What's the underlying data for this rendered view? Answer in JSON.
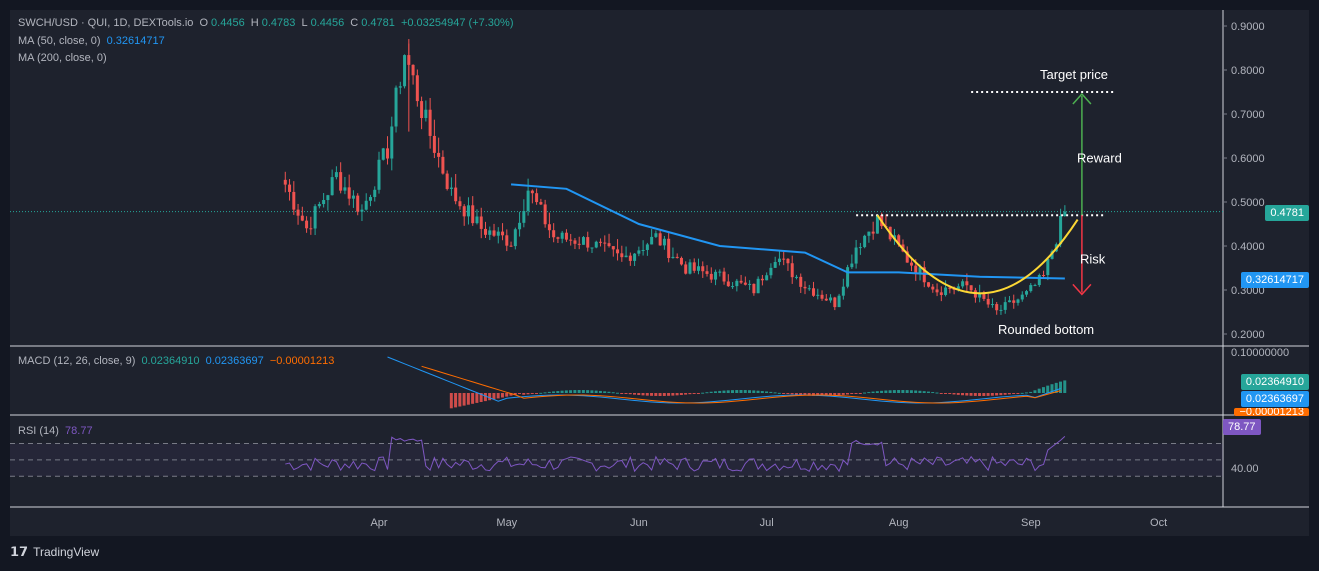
{
  "header": {
    "symbol": "SWCH/USD · QUI, 1D, DEXTools.io",
    "o_label": "O",
    "o_value": "0.4456",
    "h_label": "H",
    "h_value": "0.4783",
    "l_label": "L",
    "l_value": "0.4456",
    "c_label": "C",
    "c_value": "0.4781",
    "change": "+0.03254947 (+7.30%)"
  },
  "ma50": {
    "label": "MA (50, close, 0)",
    "value": "0.32614717"
  },
  "ma200": {
    "label": "MA (200, close, 0)"
  },
  "macd": {
    "label": "MACD (12, 26, close, 9)",
    "macd": "0.02364910",
    "signal": "0.02363697",
    "hist": "−0.00001213"
  },
  "rsi": {
    "label": "RSI (14)",
    "value": "78.77"
  },
  "annotations": {
    "target": "Target price",
    "reward": "Reward",
    "risk": "Risk",
    "bottom": "Rounded bottom"
  },
  "price_tags": {
    "last": "0.4781",
    "ma50": "0.32614717"
  },
  "macd_tags": {
    "macd": "0.02364910",
    "signal": "0.02363697",
    "hist": "−0.00001213"
  },
  "macd_axis": {
    "top": "0.10000000"
  },
  "rsi_axis": {
    "tick": "40.00"
  },
  "brand": "TradingView",
  "colors": {
    "up": "#26a69a",
    "down": "#ef5350",
    "ma50": "#2196f3",
    "macd": "#2196f3",
    "signal": "#ff6d00",
    "rsi": "#7e57c2",
    "arc": "#fdd835",
    "reward": "#4caf50",
    "risk": "#f23645"
  },
  "chart_data": {
    "type": "candlestick",
    "price_axis": {
      "ticks": [
        "0.9000",
        "0.8000",
        "0.7000",
        "0.6000",
        "0.5000",
        "0.4000",
        "0.3000",
        "0.2000"
      ],
      "range": [
        0.18,
        0.93
      ]
    },
    "x_axis": {
      "ticks": [
        "Apr",
        "May",
        "Jun",
        "Jul",
        "Aug",
        "Sep",
        "Oct"
      ]
    },
    "key_points": [
      {
        "date": "Mar 10",
        "close": 0.54
      },
      {
        "date": "Mar 15",
        "close": 0.44
      },
      {
        "date": "Mar 22",
        "close": 0.56
      },
      {
        "date": "Mar 28",
        "close": 0.48
      },
      {
        "date": "Apr 3",
        "close": 0.62
      },
      {
        "date": "Apr 7",
        "close": 0.84
      },
      {
        "date": "Apr 12",
        "close": 0.68
      },
      {
        "date": "Apr 18",
        "close": 0.52
      },
      {
        "date": "Apr 25",
        "close": 0.44
      },
      {
        "date": "May 2",
        "close": 0.41
      },
      {
        "date": "May 6",
        "close": 0.53
      },
      {
        "date": "May 12",
        "close": 0.42
      },
      {
        "date": "May 20",
        "close": 0.41
      },
      {
        "date": "May 28",
        "close": 0.37
      },
      {
        "date": "Jun 5",
        "close": 0.42
      },
      {
        "date": "Jun 12",
        "close": 0.35
      },
      {
        "date": "Jun 20",
        "close": 0.33
      },
      {
        "date": "Jun 28",
        "close": 0.3
      },
      {
        "date": "Jul 3",
        "close": 0.38
      },
      {
        "date": "Jul 10",
        "close": 0.31
      },
      {
        "date": "Jul 17",
        "close": 0.27
      },
      {
        "date": "Jul 22",
        "close": 0.4
      },
      {
        "date": "Jul 27",
        "close": 0.46
      },
      {
        "date": "Aug 3",
        "close": 0.37
      },
      {
        "date": "Aug 10",
        "close": 0.3
      },
      {
        "date": "Aug 17",
        "close": 0.31
      },
      {
        "date": "Aug 24",
        "close": 0.25
      },
      {
        "date": "Aug 31",
        "close": 0.29
      },
      {
        "date": "Sep 4",
        "close": 0.33
      },
      {
        "date": "Sep 7",
        "close": 0.42
      },
      {
        "date": "Sep 9",
        "close": 0.4781
      }
    ],
    "ma50_points": [
      {
        "date": "May 2",
        "value": 0.54
      },
      {
        "date": "May 15",
        "value": 0.53
      },
      {
        "date": "Jun 1",
        "value": 0.45
      },
      {
        "date": "Jun 20",
        "value": 0.4
      },
      {
        "date": "Jul 10",
        "value": 0.385
      },
      {
        "date": "Jul 20",
        "value": 0.34
      },
      {
        "date": "Aug 1",
        "value": 0.34
      },
      {
        "date": "Aug 20",
        "value": 0.33
      },
      {
        "date": "Sep 9",
        "value": 0.32614717
      }
    ],
    "target_price": 0.75,
    "breakout_level": 0.47,
    "risk_level": 0.29,
    "rsi_levels": {
      "upper": 70,
      "middle": 50,
      "lower": 30,
      "last": 78.77
    }
  }
}
